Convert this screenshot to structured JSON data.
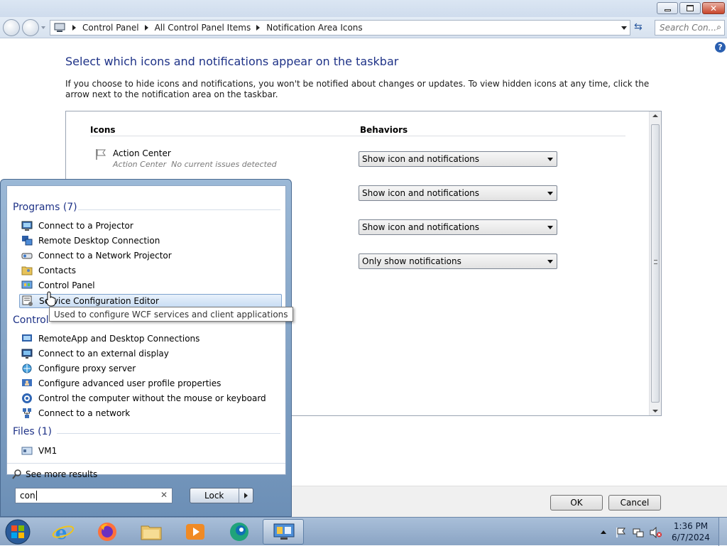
{
  "window": {
    "breadcrumbs": [
      "Control Panel",
      "All Control Panel Items",
      "Notification Area Icons"
    ],
    "search_placeholder": "Search Con..."
  },
  "content": {
    "title": "Select which icons and notifications appear on the taskbar",
    "description": "If you choose to hide icons and notifications, you won't be notified about changes or updates. To view hidden icons at any time, click the arrow next to the notification area on the taskbar.",
    "col_icons": "Icons",
    "col_behaviors": "Behaviors",
    "rows": [
      {
        "name": "Action Center",
        "detail": "Action Center  No current issues detected",
        "behavior": "Show icon and notifications",
        "icon": "flag-icon"
      },
      {
        "name": "",
        "detail": "",
        "behavior": "Show icon and notifications",
        "icon": ""
      },
      {
        "name": "",
        "detail": "",
        "behavior": "Show icon and notifications",
        "icon": ""
      },
      {
        "name": "",
        "detail": "",
        "behavior": "Only show notifications",
        "icon": ""
      }
    ],
    "ok_label": "OK",
    "cancel_label": "Cancel"
  },
  "start_menu": {
    "programs_header": "Programs (7)",
    "programs": [
      {
        "label": "Connect to a Projector",
        "icon": "projector-icon"
      },
      {
        "label": "Remote Desktop Connection",
        "icon": "remote-desktop-icon"
      },
      {
        "label": "Connect to a Network Projector",
        "icon": "network-projector-icon"
      },
      {
        "label": "Contacts",
        "icon": "contacts-icon"
      },
      {
        "label": "Control Panel",
        "icon": "control-panel-icon"
      },
      {
        "label": "Service Configuration Editor",
        "icon": "service-config-icon"
      }
    ],
    "control_header": "Control",
    "control_items": [
      {
        "label": "RemoteApp and Desktop Connections",
        "icon": "remoteapp-icon"
      },
      {
        "label": "Connect to an external display",
        "icon": "display-icon"
      },
      {
        "label": "Configure proxy server",
        "icon": "proxy-icon"
      },
      {
        "label": "Configure advanced user profile properties",
        "icon": "user-profile-icon"
      },
      {
        "label": "Control the computer without the mouse or keyboard",
        "icon": "ease-of-access-icon"
      },
      {
        "label": "Connect to a network",
        "icon": "network-icon"
      }
    ],
    "files_header": "Files (1)",
    "files": [
      {
        "label": "VM1",
        "icon": "file-icon"
      }
    ],
    "see_more": "See more results",
    "search_value": "con",
    "lock_label": "Lock",
    "tooltip": "Used to configure WCF services and client applications"
  },
  "taskbar": {
    "time": "1:36 PM",
    "date": "6/7/2024",
    "apps": [
      "start-orb-icon",
      "internet-explorer-icon",
      "firefox-icon",
      "explorer-folder-icon",
      "media-player-icon",
      "edge-icon",
      "control-panel-taskbar-icon"
    ]
  },
  "colors": {
    "accent": "#1e3287",
    "taskbar": "#9bb4d1",
    "highlight": "#c7dcf4"
  }
}
